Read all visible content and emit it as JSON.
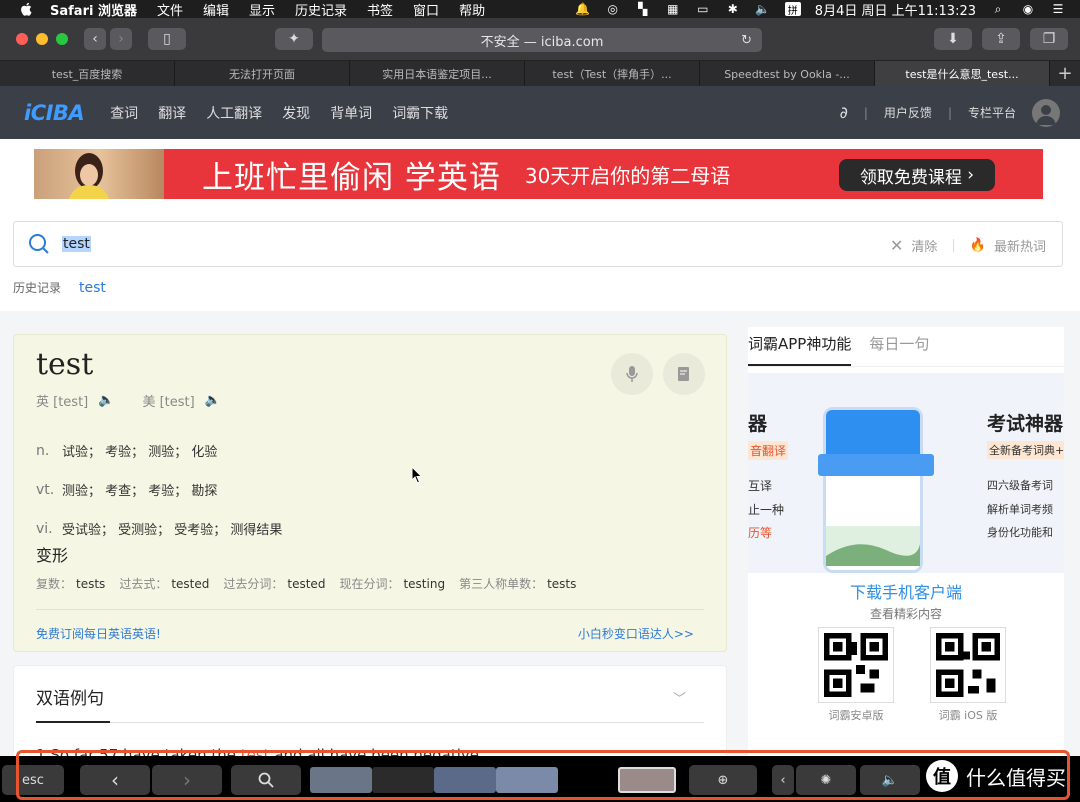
{
  "menubar": {
    "app": "Safari 浏览器",
    "items": [
      "文件",
      "编辑",
      "显示",
      "历史记录",
      "书签",
      "窗口",
      "帮助"
    ],
    "clock": "8月4日 周日 上午11:13:23",
    "input_method": "拼"
  },
  "toolbar": {
    "address": "不安全 — iciba.com"
  },
  "tabs": [
    {
      "label": "test_百度搜索"
    },
    {
      "label": "无法打开页面"
    },
    {
      "label": "实用日本语鉴定项目..."
    },
    {
      "label": "test（Test（摔角手）..."
    },
    {
      "label": "Speedtest by Ookla -..."
    },
    {
      "label": "test是什么意思_test..."
    }
  ],
  "site": {
    "logo": "iCIBA",
    "nav": [
      "查词",
      "翻译",
      "人工翻译",
      "发现",
      "背单词",
      "词霸下载"
    ],
    "feedback": "用户反馈",
    "column": "专栏平台"
  },
  "banner": {
    "title": "上班忙里偷闲 学英语",
    "subtitle": "30天开启你的第二母语",
    "cta": "领取免费课程"
  },
  "search": {
    "value": "test",
    "clear": "清除",
    "hot": "最新热词"
  },
  "history": {
    "label": "历史记录",
    "items": [
      "test"
    ]
  },
  "entry": {
    "word": "test",
    "uk": "英 [test]",
    "us": "美 [test]",
    "defs": [
      {
        "pos": "n.",
        "meaning": "试验； 考验； 测验； 化验"
      },
      {
        "pos": "vt.",
        "meaning": "测验； 考查； 考验； 勘探"
      },
      {
        "pos": "vi.",
        "meaning": "受试验； 受测验； 受考验； 测得结果"
      }
    ],
    "forms_title": "变形",
    "forms": [
      {
        "label": "复数：",
        "value": "tests"
      },
      {
        "label": "过去式：",
        "value": "tested"
      },
      {
        "label": "过去分词：",
        "value": "tested"
      },
      {
        "label": "现在分词：",
        "value": "testing"
      },
      {
        "label": "第三人称单数：",
        "value": "tests"
      }
    ],
    "link_left": "免费订阅每日英语英语!",
    "link_right": "小白秒变口语达人>>"
  },
  "examples": {
    "heading": "双语例句",
    "sentence_pre": "1.So far 57 have taken the ",
    "sentence_hl": "test",
    "sentence_post": " and all have been negative."
  },
  "sidebar": {
    "tab_active": "词霸APP神功能",
    "tab_other": "每日一句",
    "promo_left": [
      "器",
      "音翻译",
      "互译",
      "止一种",
      "历等"
    ],
    "promo_right_title": "考试神器",
    "promo_right": [
      "全新备考词典+1",
      "四六级备考词",
      "解析单词考频",
      "身份化功能和"
    ],
    "download_title": "下载手机客户端",
    "download_sub": "查看精彩内容",
    "qr_android": "词霸安卓版",
    "qr_ios": "词霸 iOS 版"
  },
  "touchbar": {
    "esc": "esc",
    "watermark": "什么值得买",
    "watermark_icon": "值"
  }
}
